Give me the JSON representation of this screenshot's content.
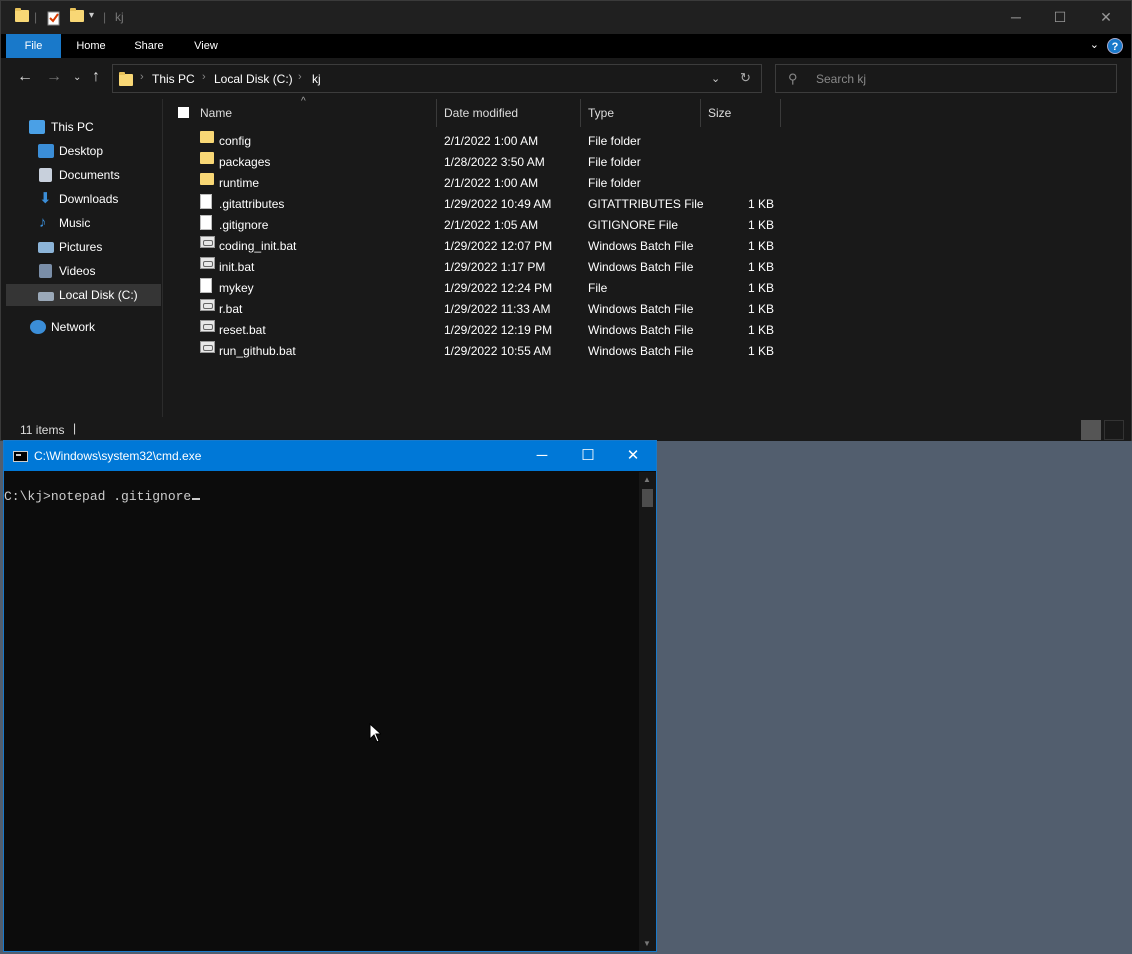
{
  "explorer": {
    "title": "kj",
    "ribbon_tabs": [
      "File",
      "Home",
      "Share",
      "View"
    ],
    "help_label": "?",
    "breadcrumb": [
      "This PC",
      "Local Disk (C:)",
      "kj"
    ],
    "search_placeholder": "Search kj",
    "sidebar": {
      "items": [
        {
          "label": "This PC",
          "icon": "this-pc-icon",
          "color": "#4aa0e6"
        },
        {
          "label": "Desktop",
          "icon": "desktop-icon",
          "color": "#3b8ed8"
        },
        {
          "label": "Documents",
          "icon": "documents-icon",
          "color": "#c8d0dc"
        },
        {
          "label": "Downloads",
          "icon": "downloads-icon",
          "color": "#3b8ed8"
        },
        {
          "label": "Music",
          "icon": "music-icon",
          "color": "#3b8ed8"
        },
        {
          "label": "Pictures",
          "icon": "pictures-icon",
          "color": "#8cb4d8"
        },
        {
          "label": "Videos",
          "icon": "videos-icon",
          "color": "#7a8ea8"
        },
        {
          "label": "Local Disk (C:)",
          "icon": "drive-icon",
          "color": "#9aa8b8"
        },
        {
          "label": "Network",
          "icon": "network-icon",
          "color": "#3b8ed8"
        }
      ]
    },
    "columns": [
      "Name",
      "Date modified",
      "Type",
      "Size"
    ],
    "files": [
      {
        "name": "config",
        "date": "2/1/2022 1:00 AM",
        "type": "File folder",
        "size": "",
        "icon": "folder"
      },
      {
        "name": "packages",
        "date": "1/28/2022 3:50 AM",
        "type": "File folder",
        "size": "",
        "icon": "folder"
      },
      {
        "name": "runtime",
        "date": "2/1/2022 1:00 AM",
        "type": "File folder",
        "size": "",
        "icon": "folder"
      },
      {
        "name": ".gitattributes",
        "date": "1/29/2022 10:49 AM",
        "type": "GITATTRIBUTES File",
        "size": "1 KB",
        "icon": "file"
      },
      {
        "name": ".gitignore",
        "date": "2/1/2022 1:05 AM",
        "type": "GITIGNORE File",
        "size": "1 KB",
        "icon": "file"
      },
      {
        "name": "coding_init.bat",
        "date": "1/29/2022 12:07 PM",
        "type": "Windows Batch File",
        "size": "1 KB",
        "icon": "bat"
      },
      {
        "name": "init.bat",
        "date": "1/29/2022 1:17 PM",
        "type": "Windows Batch File",
        "size": "1 KB",
        "icon": "bat"
      },
      {
        "name": "mykey",
        "date": "1/29/2022 12:24 PM",
        "type": "File",
        "size": "1 KB",
        "icon": "file"
      },
      {
        "name": "r.bat",
        "date": "1/29/2022 11:33 AM",
        "type": "Windows Batch File",
        "size": "1 KB",
        "icon": "bat"
      },
      {
        "name": "reset.bat",
        "date": "1/29/2022 12:19 PM",
        "type": "Windows Batch File",
        "size": "1 KB",
        "icon": "bat"
      },
      {
        "name": "run_github.bat",
        "date": "1/29/2022 10:55 AM",
        "type": "Windows Batch File",
        "size": "1 KB",
        "icon": "bat"
      }
    ],
    "status": "11 items"
  },
  "cmd": {
    "title": "C:\\Windows\\system32\\cmd.exe",
    "prompt": "C:\\kj>",
    "command": "notepad .gitignore"
  },
  "colors": {
    "accent": "#1979ca",
    "cmd_titlebar": "#0078d7",
    "desktop": "#525e6e"
  }
}
